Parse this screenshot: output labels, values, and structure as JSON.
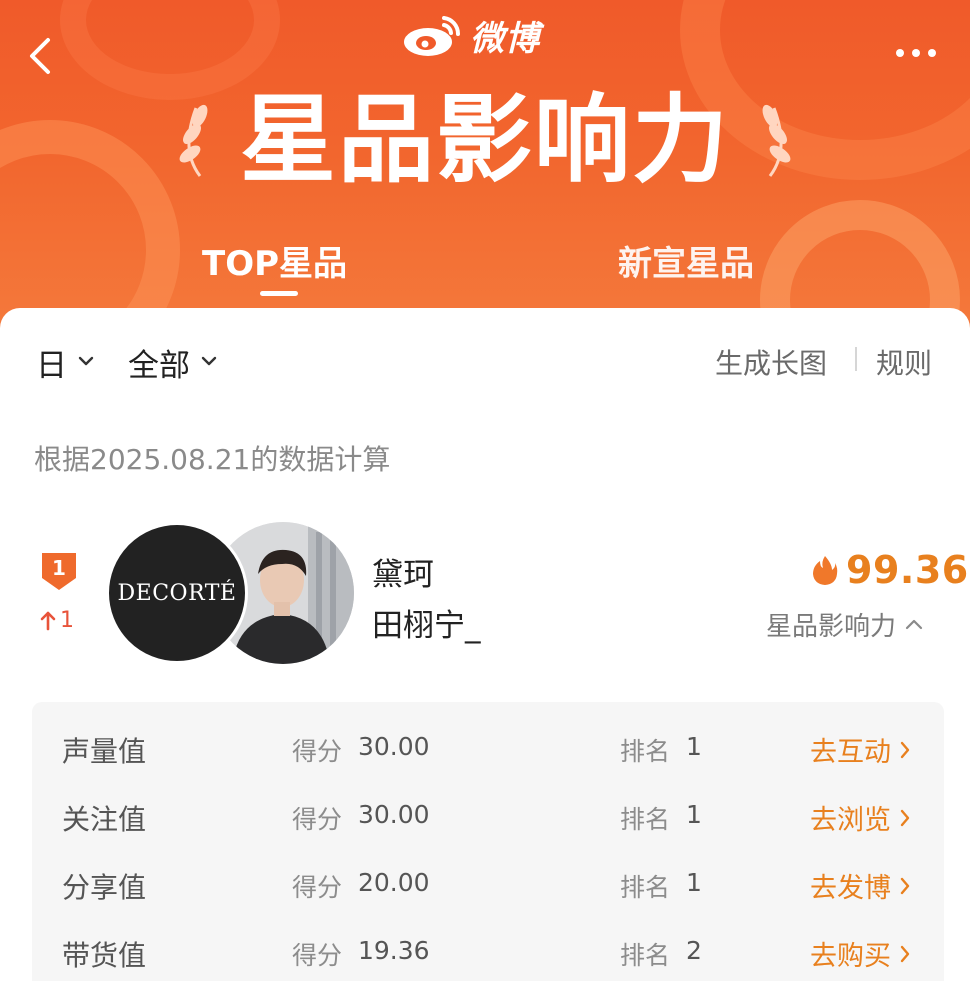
{
  "app": {
    "logo_text": "微博",
    "page_title": "星品影响力"
  },
  "tabs": [
    {
      "label": "TOP星品",
      "active": true
    },
    {
      "label": "新宣星品",
      "active": false
    }
  ],
  "filters": {
    "period": "日",
    "category": "全部"
  },
  "actions": {
    "long_image": "生成长图",
    "rules": "规则"
  },
  "data_note": "根据2025.08.21的数据计算",
  "entry": {
    "rank": "1",
    "rank_change": "1",
    "brand_logo_text": "DECORTÉ",
    "brand_name": "黛珂",
    "star_name": "田栩宁_",
    "score": "99.36",
    "score_label": "星品影响力"
  },
  "details": [
    {
      "label": "声量值",
      "score_label": "得分",
      "score": "30.00",
      "rank_label": "排名",
      "rank": "1",
      "action": "去互动"
    },
    {
      "label": "关注值",
      "score_label": "得分",
      "score": "30.00",
      "rank_label": "排名",
      "rank": "1",
      "action": "去浏览"
    },
    {
      "label": "分享值",
      "score_label": "得分",
      "score": "20.00",
      "rank_label": "排名",
      "rank": "1",
      "action": "去发博"
    },
    {
      "label": "带货值",
      "score_label": "得分",
      "score": "19.36",
      "rank_label": "排名",
      "rank": "2",
      "action": "去购买"
    }
  ],
  "colors": {
    "header_orange": "#f05a2a",
    "accent_orange": "#e8801e",
    "rank_up_red": "#e8533a"
  },
  "icons": {
    "back": "chevron-left-icon",
    "more": "more-dots-icon",
    "logo": "weibo-logo-icon",
    "dropdown": "chevron-down-icon",
    "rank_badge": "rank-shield-icon",
    "rank_up": "arrow-up-icon",
    "hot": "flame-icon",
    "collapse": "chevron-up-icon",
    "go": "chevron-right-icon"
  }
}
